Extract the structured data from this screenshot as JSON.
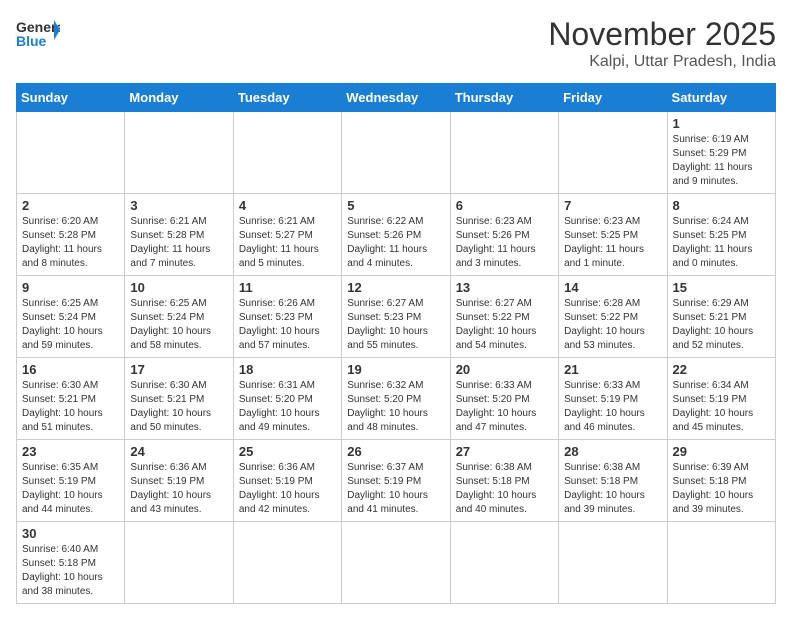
{
  "header": {
    "logo_general": "General",
    "logo_blue": "Blue",
    "month_title": "November 2025",
    "location": "Kalpi, Uttar Pradesh, India"
  },
  "days_of_week": [
    "Sunday",
    "Monday",
    "Tuesday",
    "Wednesday",
    "Thursday",
    "Friday",
    "Saturday"
  ],
  "weeks": [
    [
      {
        "day": "",
        "info": ""
      },
      {
        "day": "",
        "info": ""
      },
      {
        "day": "",
        "info": ""
      },
      {
        "day": "",
        "info": ""
      },
      {
        "day": "",
        "info": ""
      },
      {
        "day": "",
        "info": ""
      },
      {
        "day": "1",
        "info": "Sunrise: 6:19 AM\nSunset: 5:29 PM\nDaylight: 11 hours and 9 minutes."
      }
    ],
    [
      {
        "day": "2",
        "info": "Sunrise: 6:20 AM\nSunset: 5:28 PM\nDaylight: 11 hours and 8 minutes."
      },
      {
        "day": "3",
        "info": "Sunrise: 6:21 AM\nSunset: 5:28 PM\nDaylight: 11 hours and 7 minutes."
      },
      {
        "day": "4",
        "info": "Sunrise: 6:21 AM\nSunset: 5:27 PM\nDaylight: 11 hours and 5 minutes."
      },
      {
        "day": "5",
        "info": "Sunrise: 6:22 AM\nSunset: 5:26 PM\nDaylight: 11 hours and 4 minutes."
      },
      {
        "day": "6",
        "info": "Sunrise: 6:23 AM\nSunset: 5:26 PM\nDaylight: 11 hours and 3 minutes."
      },
      {
        "day": "7",
        "info": "Sunrise: 6:23 AM\nSunset: 5:25 PM\nDaylight: 11 hours and 1 minute."
      },
      {
        "day": "8",
        "info": "Sunrise: 6:24 AM\nSunset: 5:25 PM\nDaylight: 11 hours and 0 minutes."
      }
    ],
    [
      {
        "day": "9",
        "info": "Sunrise: 6:25 AM\nSunset: 5:24 PM\nDaylight: 10 hours and 59 minutes."
      },
      {
        "day": "10",
        "info": "Sunrise: 6:25 AM\nSunset: 5:24 PM\nDaylight: 10 hours and 58 minutes."
      },
      {
        "day": "11",
        "info": "Sunrise: 6:26 AM\nSunset: 5:23 PM\nDaylight: 10 hours and 57 minutes."
      },
      {
        "day": "12",
        "info": "Sunrise: 6:27 AM\nSunset: 5:23 PM\nDaylight: 10 hours and 55 minutes."
      },
      {
        "day": "13",
        "info": "Sunrise: 6:27 AM\nSunset: 5:22 PM\nDaylight: 10 hours and 54 minutes."
      },
      {
        "day": "14",
        "info": "Sunrise: 6:28 AM\nSunset: 5:22 PM\nDaylight: 10 hours and 53 minutes."
      },
      {
        "day": "15",
        "info": "Sunrise: 6:29 AM\nSunset: 5:21 PM\nDaylight: 10 hours and 52 minutes."
      }
    ],
    [
      {
        "day": "16",
        "info": "Sunrise: 6:30 AM\nSunset: 5:21 PM\nDaylight: 10 hours and 51 minutes."
      },
      {
        "day": "17",
        "info": "Sunrise: 6:30 AM\nSunset: 5:21 PM\nDaylight: 10 hours and 50 minutes."
      },
      {
        "day": "18",
        "info": "Sunrise: 6:31 AM\nSunset: 5:20 PM\nDaylight: 10 hours and 49 minutes."
      },
      {
        "day": "19",
        "info": "Sunrise: 6:32 AM\nSunset: 5:20 PM\nDaylight: 10 hours and 48 minutes."
      },
      {
        "day": "20",
        "info": "Sunrise: 6:33 AM\nSunset: 5:20 PM\nDaylight: 10 hours and 47 minutes."
      },
      {
        "day": "21",
        "info": "Sunrise: 6:33 AM\nSunset: 5:19 PM\nDaylight: 10 hours and 46 minutes."
      },
      {
        "day": "22",
        "info": "Sunrise: 6:34 AM\nSunset: 5:19 PM\nDaylight: 10 hours and 45 minutes."
      }
    ],
    [
      {
        "day": "23",
        "info": "Sunrise: 6:35 AM\nSunset: 5:19 PM\nDaylight: 10 hours and 44 minutes."
      },
      {
        "day": "24",
        "info": "Sunrise: 6:36 AM\nSunset: 5:19 PM\nDaylight: 10 hours and 43 minutes."
      },
      {
        "day": "25",
        "info": "Sunrise: 6:36 AM\nSunset: 5:19 PM\nDaylight: 10 hours and 42 minutes."
      },
      {
        "day": "26",
        "info": "Sunrise: 6:37 AM\nSunset: 5:19 PM\nDaylight: 10 hours and 41 minutes."
      },
      {
        "day": "27",
        "info": "Sunrise: 6:38 AM\nSunset: 5:18 PM\nDaylight: 10 hours and 40 minutes."
      },
      {
        "day": "28",
        "info": "Sunrise: 6:38 AM\nSunset: 5:18 PM\nDaylight: 10 hours and 39 minutes."
      },
      {
        "day": "29",
        "info": "Sunrise: 6:39 AM\nSunset: 5:18 PM\nDaylight: 10 hours and 39 minutes."
      }
    ],
    [
      {
        "day": "30",
        "info": "Sunrise: 6:40 AM\nSunset: 5:18 PM\nDaylight: 10 hours and 38 minutes."
      },
      {
        "day": "",
        "info": ""
      },
      {
        "day": "",
        "info": ""
      },
      {
        "day": "",
        "info": ""
      },
      {
        "day": "",
        "info": ""
      },
      {
        "day": "",
        "info": ""
      },
      {
        "day": "",
        "info": ""
      }
    ]
  ]
}
